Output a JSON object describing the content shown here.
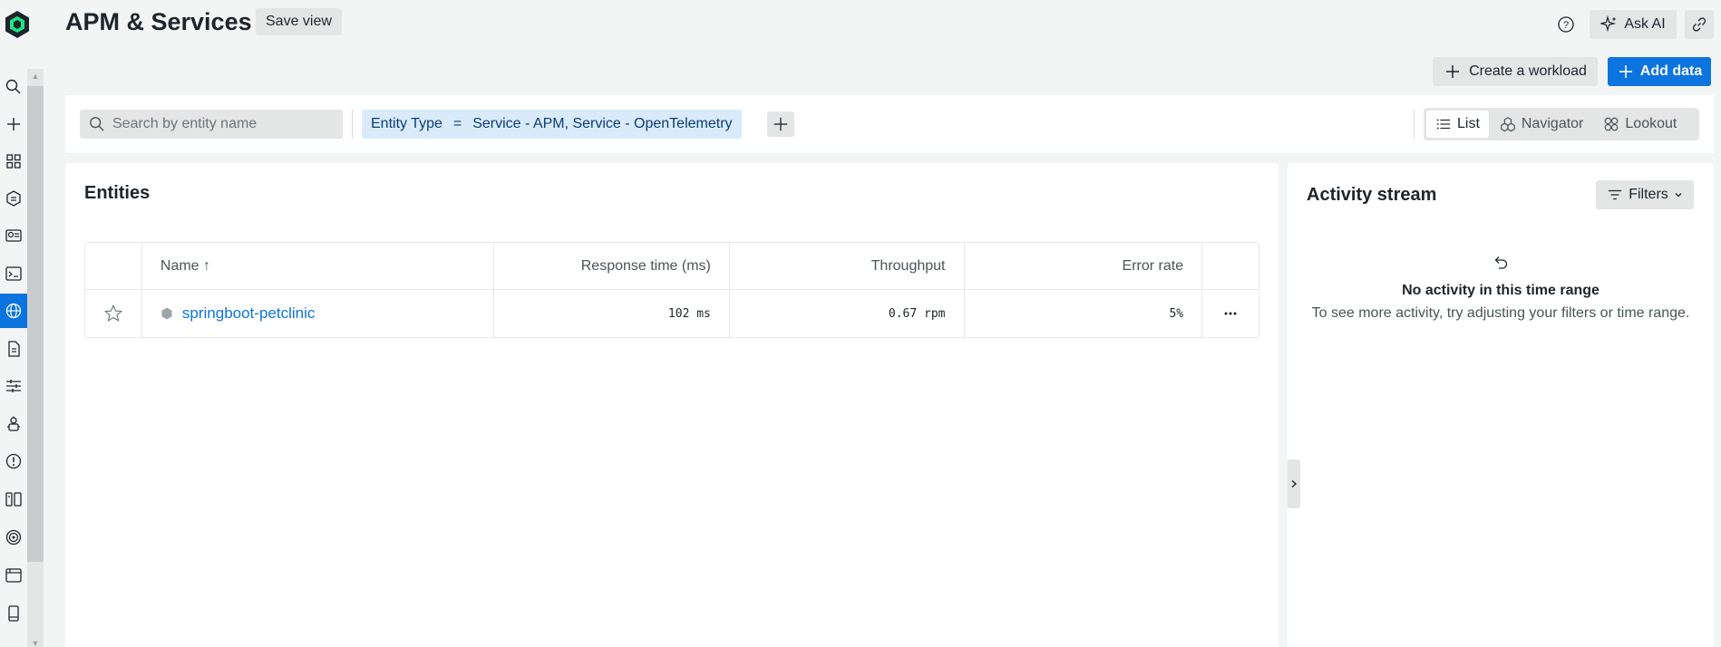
{
  "header": {
    "title": "APM & Services",
    "save_view": "Save view",
    "ask_ai": "Ask AI",
    "create_workload": "Create a workload",
    "add_data": "Add data"
  },
  "filter": {
    "search_placeholder": "Search by entity name",
    "chip_key": "Entity Type",
    "chip_op": "=",
    "chip_value": "Service - APM, Service - OpenTelemetry"
  },
  "views": [
    {
      "label": "List",
      "icon": "list-icon",
      "active": true
    },
    {
      "label": "Navigator",
      "icon": "navigator-icon",
      "active": false
    },
    {
      "label": "Lookout",
      "icon": "lookout-icon",
      "active": false
    }
  ],
  "entities": {
    "title": "Entities",
    "columns": {
      "name": "Name ↑",
      "response_time": "Response time (ms)",
      "throughput": "Throughput",
      "error_rate": "Error rate"
    },
    "rows": [
      {
        "name": "springboot-petclinic",
        "response_time": "102 ms",
        "throughput": "0.67 rpm",
        "error_rate": "5%"
      }
    ]
  },
  "activity": {
    "title": "Activity stream",
    "filters": "Filters",
    "empty_title": "No activity in this time range",
    "empty_desc": "To see more activity, try adjusting your filters or time range."
  },
  "colors": {
    "accent": "#0c74df",
    "chip_bg": "#d9ebfb",
    "chip_text": "#0b3b75",
    "logo": "#1ce783"
  },
  "nav_icons": [
    "search-icon",
    "add-icon",
    "apps-icon",
    "hexagon-icon",
    "dashboards-icon",
    "query-icon",
    "globe-icon",
    "logs-icon",
    "settings-icon",
    "ai-robot-icon",
    "alert-icon",
    "book-icon",
    "target-icon",
    "browser-icon",
    "mobile-icon"
  ]
}
